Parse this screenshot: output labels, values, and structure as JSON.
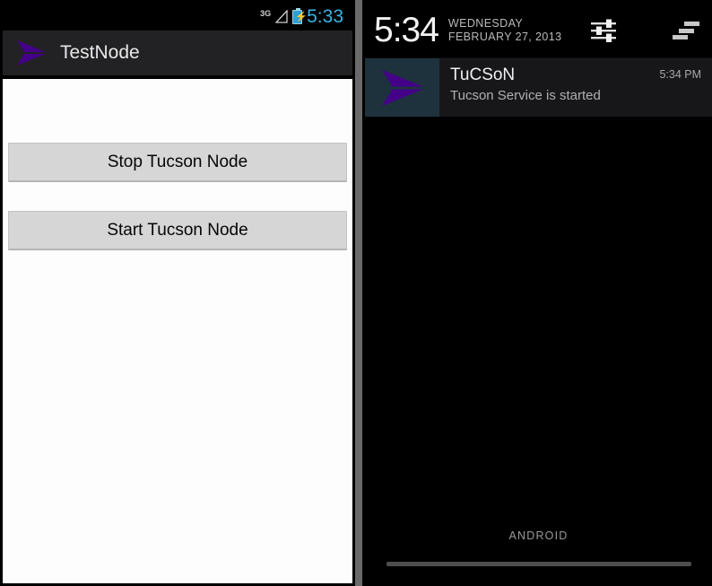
{
  "left_phone": {
    "statusbar": {
      "network_label": "3G",
      "signal_icon": "signal-triangle-icon",
      "battery_icon": "battery-charging-icon",
      "clock": "5:33",
      "clock_color": "#33b5e5"
    },
    "app": {
      "logo_icon": "tucson-dart-logo-icon",
      "title": "TestNode",
      "logo_color": "#440088",
      "buttons": [
        {
          "label": "Stop Tucson Node",
          "name": "stop-tucson-node-button"
        },
        {
          "label": "Start Tucson Node",
          "name": "start-tucson-node-button"
        }
      ]
    }
  },
  "right_phone": {
    "shade": {
      "clock": "5:34",
      "date_line1": "WEDNESDAY",
      "date_line2": "FEBRUARY 27, 2013",
      "settings_icon": "settings-sliders-icon",
      "clear_all_icon": "clear-all-notifications-icon",
      "footer_label": "ANDROID",
      "drag_handle": "notification-shade-drag-handle"
    },
    "notification": {
      "icon": "tucson-dart-logo-icon",
      "icon_bg": "#1e323e",
      "title": "TuCSoN",
      "body": "Tucson Service is started",
      "time": "5:34 PM"
    }
  }
}
